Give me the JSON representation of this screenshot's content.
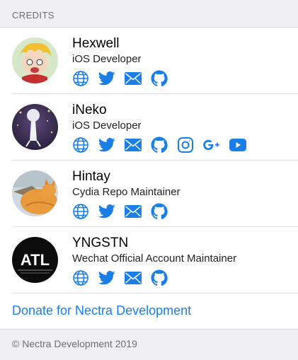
{
  "section": {
    "title": "CREDITS"
  },
  "credits": [
    {
      "name": "Hexwell",
      "role": "iOS Developer",
      "icons": [
        "globe-icon",
        "twitter-icon",
        "mail-icon",
        "github-icon"
      ]
    },
    {
      "name": "iNeko",
      "role": "iOS Developer",
      "icons": [
        "globe-icon",
        "twitter-icon",
        "mail-icon",
        "github-icon",
        "instagram-icon",
        "google-plus-icon",
        "youtube-icon"
      ]
    },
    {
      "name": "Hintay",
      "role": "Cydia Repo Maintainer",
      "icons": [
        "globe-icon",
        "twitter-icon",
        "mail-icon",
        "github-icon"
      ]
    },
    {
      "name": "YNGSTN",
      "role": "Wechat Official Account Maintainer",
      "icons": [
        "globe-icon",
        "twitter-icon",
        "mail-icon",
        "github-icon"
      ],
      "avatar_text": "ATL"
    }
  ],
  "donate": {
    "label": "Donate for Nectra Development"
  },
  "footer": {
    "text": "© Nectra Development 2019"
  },
  "colors": {
    "accent": "#1a7ee8",
    "background": "#efeff4",
    "secondary_text": "#6d6d72"
  }
}
